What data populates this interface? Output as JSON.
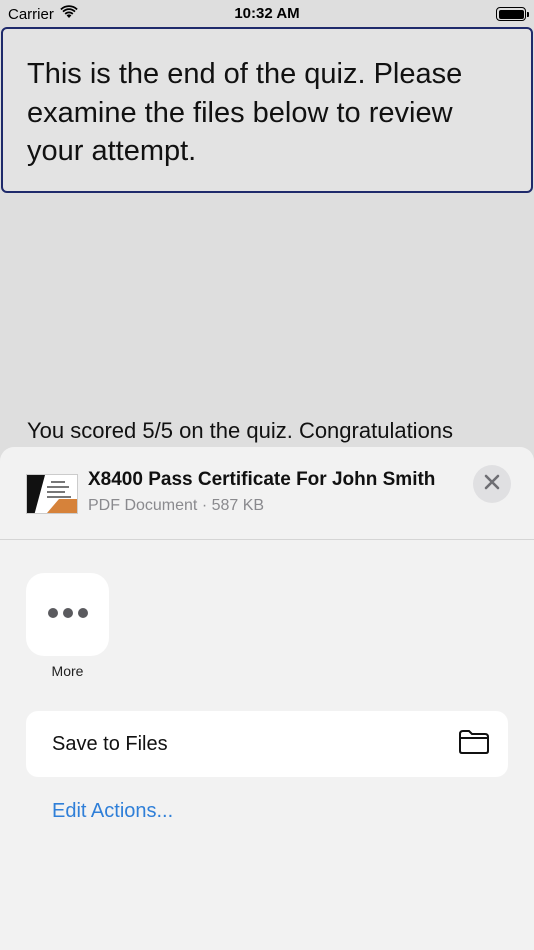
{
  "status_bar": {
    "carrier": "Carrier",
    "time": "10:32 AM"
  },
  "quiz": {
    "banner_text": "This is the end of the quiz. Please examine the files below to review your attempt.",
    "score_text": "You scored 5/5 on the quiz. Congratulations"
  },
  "share_sheet": {
    "file_name": "X8400 Pass Certificate For John Smith",
    "file_meta": "PDF Document · 587 KB",
    "more_label": "More",
    "save_to_files_label": "Save to Files",
    "edit_actions_label": "Edit Actions..."
  },
  "colors": {
    "link_blue": "#2f7fd8",
    "banner_border": "#1f2a6b",
    "sheet_background": "#f2f2f2"
  },
  "icons": {
    "signal": "wifi-icon",
    "battery": "battery-icon",
    "close": "close-icon",
    "more": "ellipsis-icon",
    "folder": "folder-icon"
  }
}
